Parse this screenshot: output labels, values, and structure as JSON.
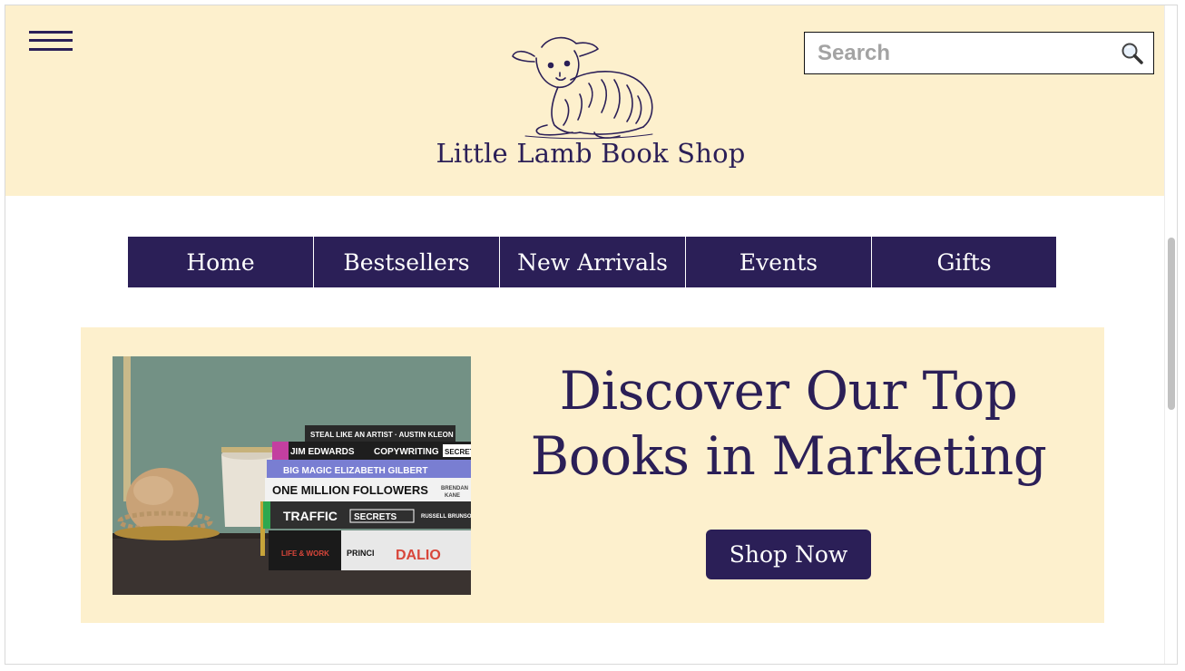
{
  "header": {
    "menu_icon": "hamburger-menu-icon",
    "logo_icon": "lamb-logo-icon",
    "shop_name": "Little Lamb Book Shop",
    "search": {
      "placeholder": "Search",
      "value": "",
      "icon": "magnifier-icon"
    }
  },
  "nav": {
    "items": [
      {
        "label": "Home"
      },
      {
        "label": "Bestsellers"
      },
      {
        "label": "New Arrivals"
      },
      {
        "label": "Events"
      },
      {
        "label": "Gifts"
      }
    ]
  },
  "banner": {
    "title_line1": "Discover Our Top",
    "title_line2": "Books in Marketing",
    "cta_label": "Shop Now",
    "image": {
      "books": [
        {
          "title": "STEAL LIKE AN ARTIST · AUSTIN KLEON",
          "color": "#2a2a2a"
        },
        {
          "title": "JIM EDWARDS   COPYWRITING SECRETS",
          "color": "#1e1e1e"
        },
        {
          "title": "BIG MAGIC  ELIZABETH GILBERT",
          "color": "#4a7fd0"
        },
        {
          "title": "ONE MILLION FOLLOWERS   BRENDAN KANE",
          "color": "#f2f2f2"
        },
        {
          "title": "TRAFFIC SECRETS   RUSSELL BRUNSON",
          "color": "#2f2f2f"
        },
        {
          "title": "LIFE & WORK  PRINCIPLES  DALIO",
          "color": "#e8e8e8"
        }
      ]
    }
  },
  "colors": {
    "brand_purple": "#2b1f57",
    "cream": "#fdf0cd"
  }
}
